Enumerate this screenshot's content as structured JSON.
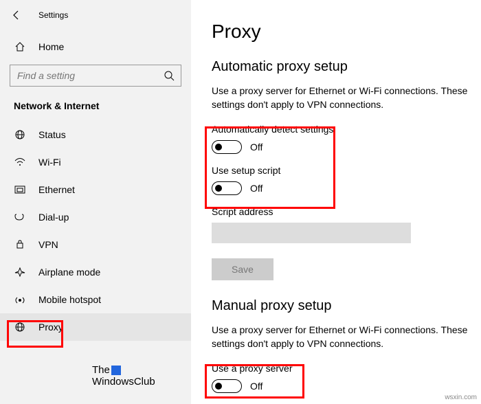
{
  "app": {
    "title": "Settings"
  },
  "sidebar": {
    "home": "Home",
    "search_placeholder": "Find a setting",
    "section": "Network & Internet",
    "items": [
      {
        "label": "Status"
      },
      {
        "label": "Wi-Fi"
      },
      {
        "label": "Ethernet"
      },
      {
        "label": "Dial-up"
      },
      {
        "label": "VPN"
      },
      {
        "label": "Airplane mode"
      },
      {
        "label": "Mobile hotspot"
      },
      {
        "label": "Proxy"
      }
    ]
  },
  "content": {
    "title": "Proxy",
    "auto": {
      "heading": "Automatic proxy setup",
      "desc": "Use a proxy server for Ethernet or Wi-Fi connections. These settings don't apply to VPN connections.",
      "toggle1_label": "Automatically detect settings",
      "toggle1_state": "Off",
      "toggle2_label": "Use setup script",
      "toggle2_state": "Off",
      "script_label": "Script address",
      "save": "Save"
    },
    "manual": {
      "heading": "Manual proxy setup",
      "desc": "Use a proxy server for Ethernet or Wi-Fi connections. These settings don't apply to VPN connections.",
      "toggle_label": "Use a proxy server",
      "toggle_state": "Off"
    }
  },
  "watermark": {
    "line1": "The",
    "line2": "WindowsClub"
  },
  "footer": "wsxin.com"
}
